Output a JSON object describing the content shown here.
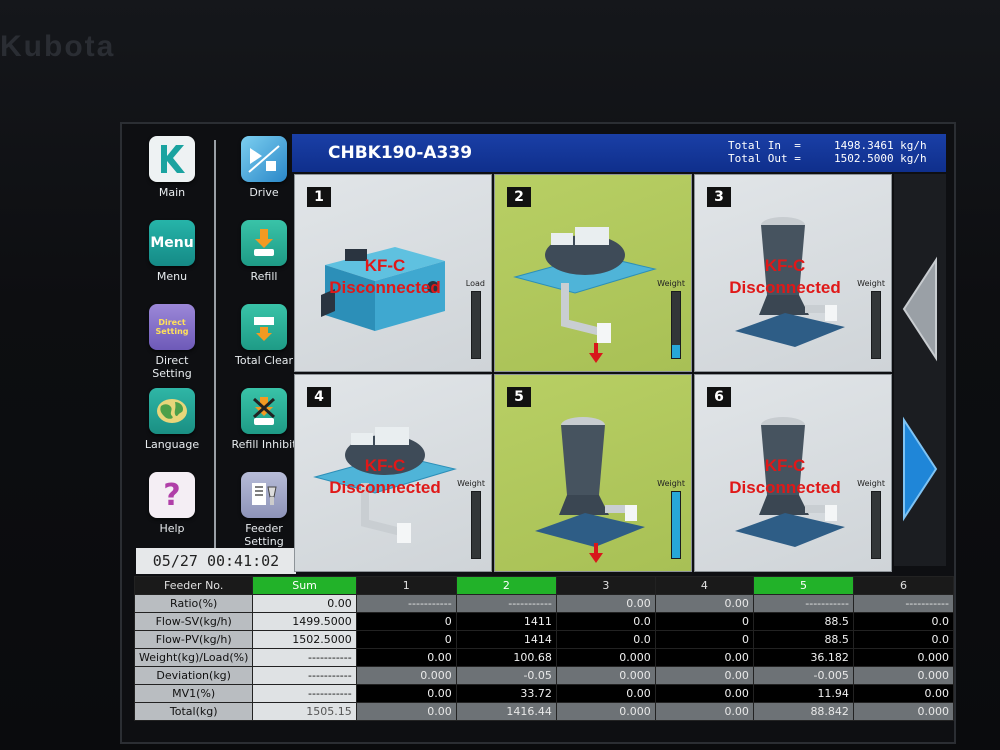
{
  "brand": "Kubota",
  "header": {
    "title": "CHBK190-A339",
    "total_in": "Total In  =     1498.3461 kg/h",
    "total_out": "Total Out =     1502.5000 kg/h"
  },
  "datetime": "05/27 00:41:02",
  "nav": [
    {
      "label": "Main",
      "icon": "kubota-k-icon"
    },
    {
      "label": "Drive",
      "icon": "drive-icon"
    },
    {
      "label": "Menu",
      "icon": "menu-icon"
    },
    {
      "label": "Refill",
      "icon": "refill-icon"
    },
    {
      "label": "Direct\nSetting",
      "icon": "direct-setting-icon"
    },
    {
      "label": "Total Clear",
      "icon": "total-clear-icon"
    },
    {
      "label": "Language",
      "icon": "globe-icon"
    },
    {
      "label": "Refill Inhibit",
      "icon": "refill-inhibit-icon"
    },
    {
      "label": "Help",
      "icon": "help-icon"
    },
    {
      "label": "Feeder\nSetting",
      "icon": "feeder-setting-icon"
    }
  ],
  "nav_menu_icon_text": "Menu",
  "nav_direct_icon_text": "Direct Setting",
  "panels": [
    {
      "num": "1",
      "status_line1": "KF-C",
      "status_line2": "Disconnected",
      "gauge_label": "Load",
      "gauge_level": 0,
      "active": false
    },
    {
      "num": "2",
      "status_line1": "",
      "status_line2": "",
      "gauge_label": "Weight",
      "gauge_level": 0.2,
      "active": true
    },
    {
      "num": "3",
      "status_line1": "KF-C",
      "status_line2": "Disconnected",
      "gauge_label": "Weight",
      "gauge_level": 0,
      "active": false
    },
    {
      "num": "4",
      "status_line1": "KF-C",
      "status_line2": "Disconnected",
      "gauge_label": "Weight",
      "gauge_level": 0,
      "active": false
    },
    {
      "num": "5",
      "status_line1": "",
      "status_line2": "",
      "gauge_label": "Weight",
      "gauge_level": 1.0,
      "active": true
    },
    {
      "num": "6",
      "status_line1": "KF-C",
      "status_line2": "Disconnected",
      "gauge_label": "Weight",
      "gauge_level": 0,
      "active": false
    }
  ],
  "table": {
    "headers": [
      "Feeder No.",
      "Sum",
      "1",
      "2",
      "3",
      "4",
      "5",
      "6"
    ],
    "active_columns": [
      "Sum",
      "2",
      "5"
    ],
    "rows": [
      {
        "label": "Ratio(%)",
        "cells": [
          "0.00",
          "-----------",
          "-----------",
          "0.00",
          "0.00",
          "-----------",
          "-----------"
        ]
      },
      {
        "label": "Flow-SV(kg/h)",
        "cells": [
          "1499.5000",
          "0",
          "1411",
          "0.0",
          "0",
          "88.5",
          "0.0"
        ]
      },
      {
        "label": "Flow-PV(kg/h)",
        "cells": [
          "1502.5000",
          "0",
          "1414",
          "0.0",
          "0",
          "88.5",
          "0.0"
        ]
      },
      {
        "label": "Weight(kg)/Load(%)",
        "cells": [
          "-----------",
          "0.00",
          "100.68",
          "0.000",
          "0.00",
          "36.182",
          "0.000"
        ]
      },
      {
        "label": "Deviation(kg)",
        "cells": [
          "-----------",
          "0.000",
          "-0.05",
          "0.000",
          "0.00",
          "-0.005",
          "0.000"
        ]
      },
      {
        "label": "MV1(%)",
        "cells": [
          "-----------",
          "0.00",
          "33.72",
          "0.00",
          "0.00",
          "11.94",
          "0.00"
        ]
      },
      {
        "label": "Total(kg)",
        "cells": [
          "1505.15",
          "0.00",
          "1416.44",
          "0.000",
          "0.00",
          "88.842",
          "0.000"
        ]
      }
    ]
  },
  "colors": {
    "header_blue": "#1a3fa6",
    "active_green": "#22b229",
    "panel_green": "#b8cf64",
    "status_red": "#e01818",
    "gauge_blue": "#27a7d8",
    "arrow_blue": "#1f86d8"
  }
}
